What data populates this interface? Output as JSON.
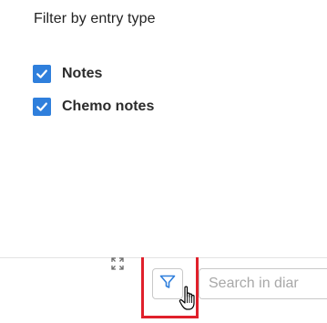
{
  "filter": {
    "title": "Filter by entry type",
    "options": [
      {
        "label": "Notes",
        "checked": true
      },
      {
        "label": "Chemo notes",
        "checked": true
      }
    ]
  },
  "toolbar": {
    "expand_icon": "expand-arrows-icon",
    "filter_icon": "funnel-icon",
    "search": {
      "placeholder": "Search in diar",
      "value": ""
    }
  },
  "colors": {
    "checkbox": "#2f7fdc",
    "highlight": "#e0202b",
    "filter_icon": "#2f7fdc"
  }
}
